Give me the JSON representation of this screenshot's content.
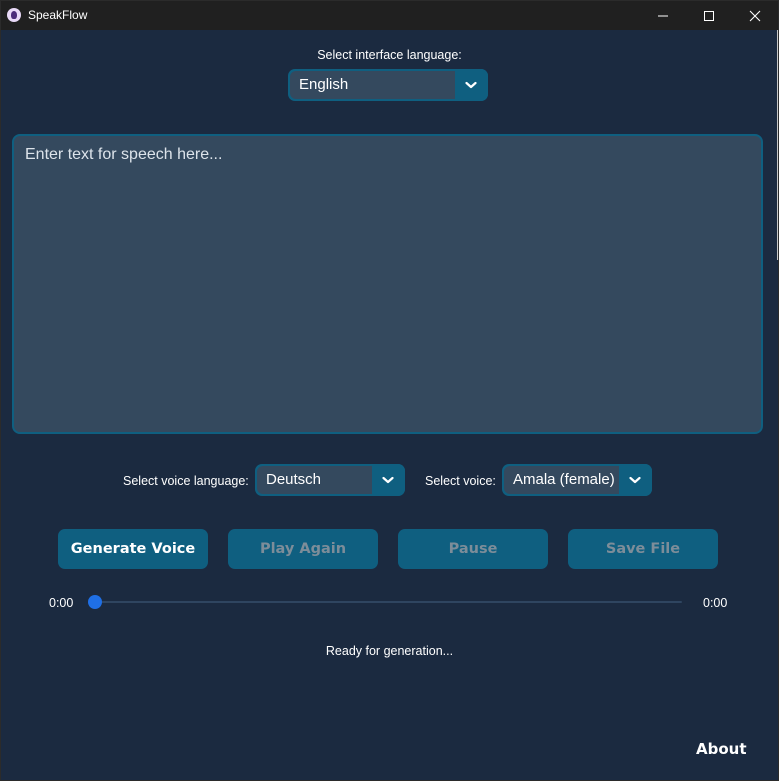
{
  "window": {
    "title": "SpeakFlow",
    "controls": {
      "minimize_icon": "minimize-icon",
      "maximize_icon": "maximize-icon",
      "close_icon": "close-icon"
    }
  },
  "interface_language": {
    "label": "Select interface language:",
    "selected": "English"
  },
  "text_input": {
    "placeholder": "Enter text for speech here...",
    "value": ""
  },
  "voice_language": {
    "label": "Select voice language:",
    "selected": "Deutsch"
  },
  "voice": {
    "label": "Select voice:",
    "selected": "Amala (female)"
  },
  "buttons": {
    "generate": "Generate Voice",
    "play_again": "Play Again",
    "pause": "Pause",
    "save_file": "Save File"
  },
  "player": {
    "current_time": "0:00",
    "total_time": "0:00",
    "progress": 0
  },
  "status": "Ready for generation...",
  "about": "About",
  "colors": {
    "background": "#1b2a40",
    "accent": "#0f5f80",
    "field": "#34495e",
    "slider_thumb": "#1f6fe5",
    "disabled_text": "#7d8d99"
  }
}
